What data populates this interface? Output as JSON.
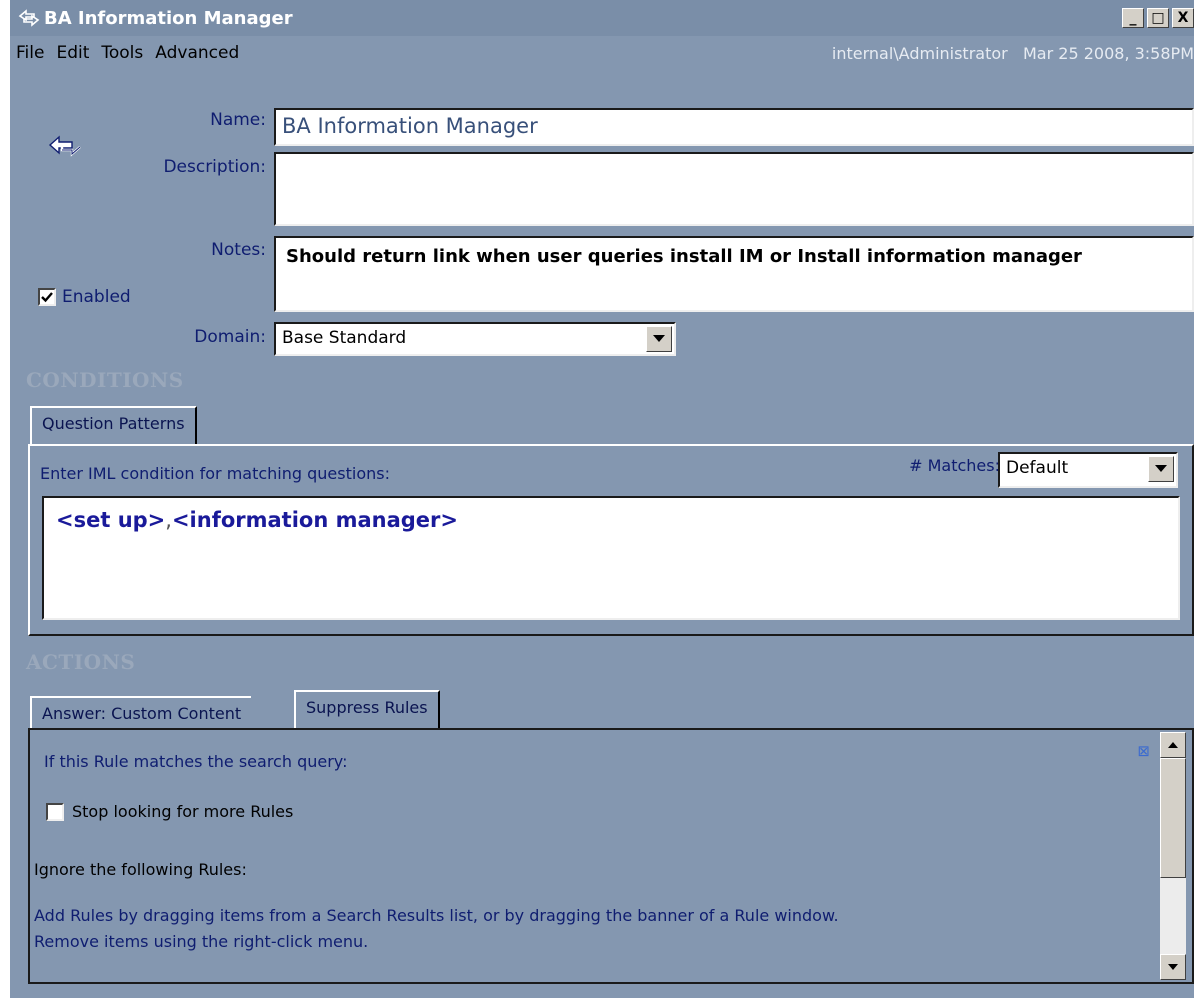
{
  "window": {
    "title": "BA Information Manager",
    "icon": "double-arrow-icon",
    "controls": {
      "minimize": "_",
      "maximize": "□",
      "close": "X"
    }
  },
  "menubar": {
    "items": [
      "File",
      "Edit",
      "Tools",
      "Advanced"
    ],
    "user": "internal\\Administrator",
    "datetime": "Mar 25 2008, 3:58PM"
  },
  "form": {
    "name_label": "Name:",
    "name_value": "BA Information Manager",
    "description_label": "Description:",
    "description_value": "",
    "notes_label": "Notes:",
    "notes_value": "Should return link when user queries install IM or Install information manager",
    "enabled_label": "Enabled",
    "enabled_checked": true,
    "domain_label": "Domain:",
    "domain_value": "Base Standard"
  },
  "conditions": {
    "heading": "CONDITIONS",
    "tab_label": "Question Patterns",
    "instruction": "Enter IML condition for matching questions:",
    "matches_label": "# Matches:",
    "matches_value": "Default",
    "iml_prefix": "<set up>",
    "iml_sep": ",",
    "iml_suffix": "<information manager>"
  },
  "actions": {
    "heading": "ACTIONS",
    "tabs": [
      "Answer: Custom Content",
      "Suppress Rules"
    ],
    "active_tab": "Suppress Rules",
    "if_text": "If this Rule matches the search query:",
    "stop_label": "Stop looking for more Rules",
    "stop_checked": false,
    "ignore_label": "Ignore the following Rules:",
    "help_line1": "Add Rules by dragging items from a Search Results list, or by dragging the banner of a Rule window.",
    "help_line2": "Remove items using the right-click menu."
  },
  "colors": {
    "window_bg": "#8497b0",
    "label_blue": "#0f1d70",
    "iml_blue": "#1a1a9a",
    "section_gray": "#9aa8bb"
  }
}
